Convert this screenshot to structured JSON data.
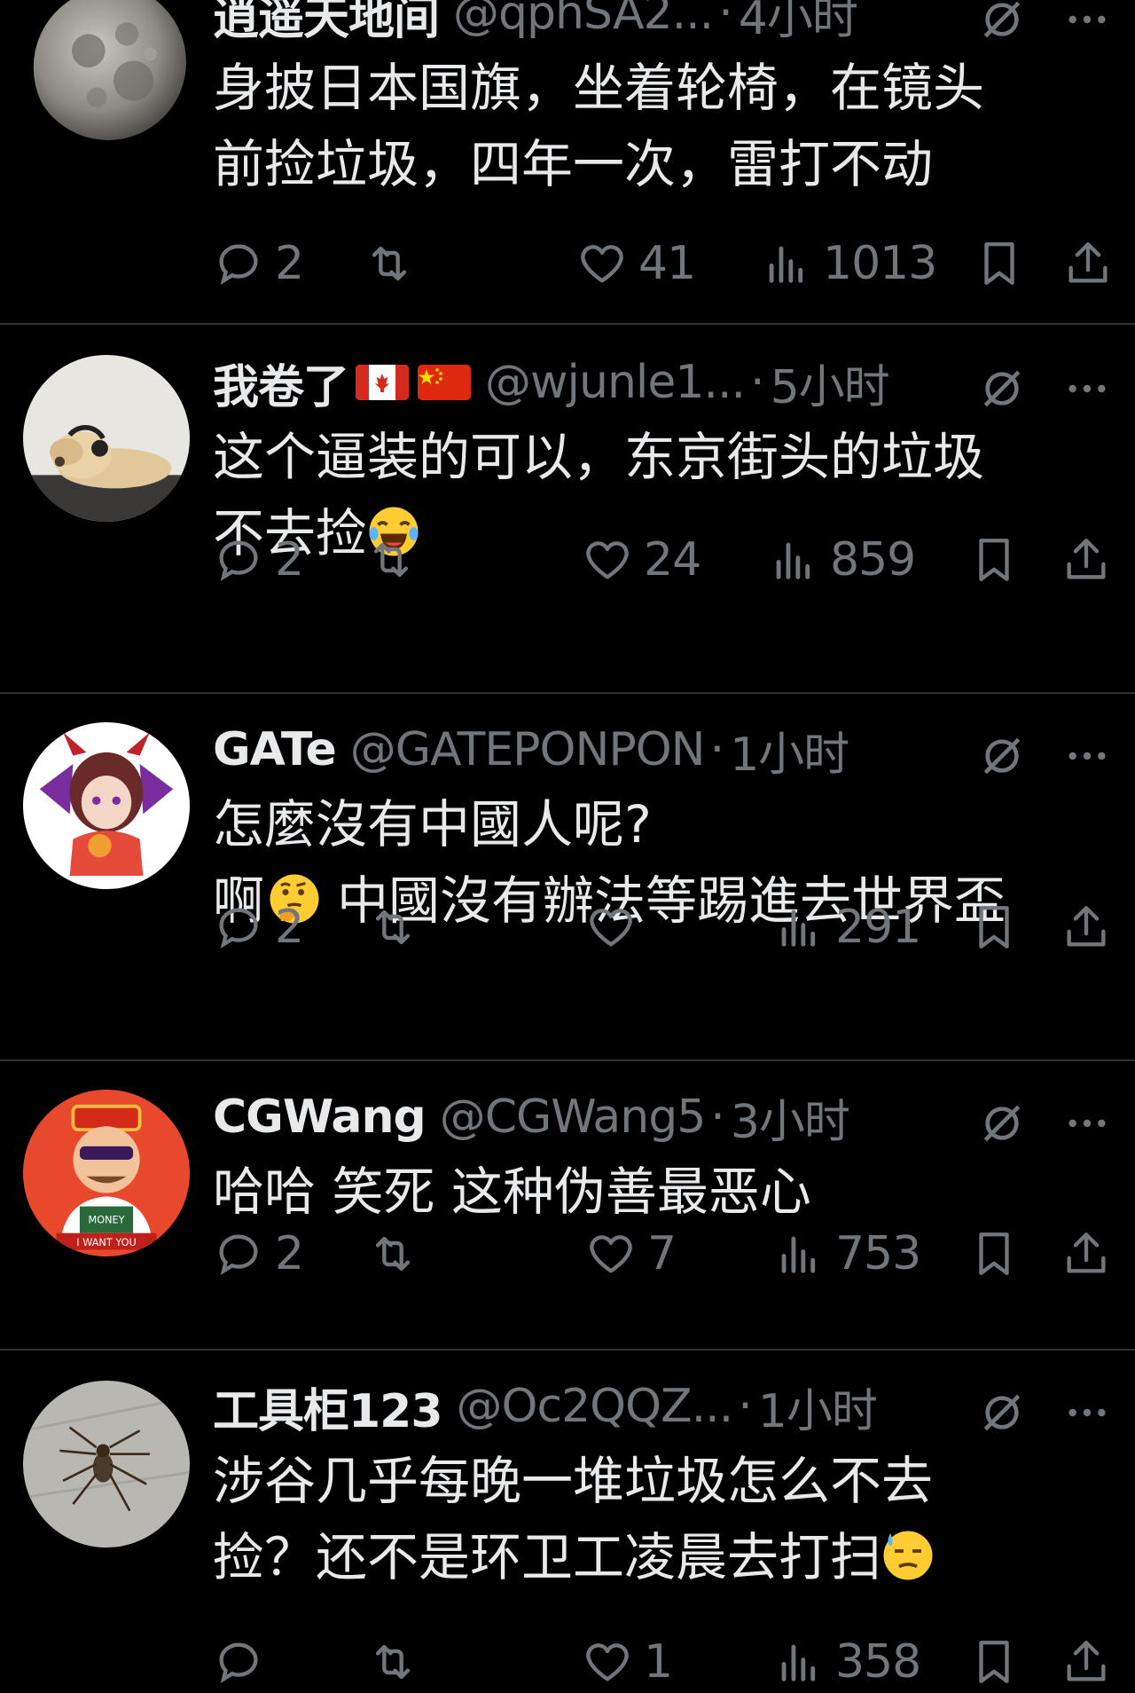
{
  "tweets": [
    {
      "name": "逍遥天地间",
      "handle": "@qphSA2...",
      "sep": "·",
      "time": "4小时",
      "lines": [
        "身披日本国旗，坐着轮椅，在镜头",
        "前捡垃圾，四年一次，雷打不动"
      ],
      "replies": "2",
      "retweets": "",
      "likes": "41",
      "views": "1013"
    },
    {
      "name": "我卷了",
      "handle": "@wjunle1...",
      "sep": "·",
      "time": "5小时",
      "lines": [
        "这个逼装的可以，东京街头的垃圾",
        "不去捡"
      ],
      "replies": "2",
      "retweets": "",
      "likes": "24",
      "views": "859"
    },
    {
      "name": "GATe",
      "handle": "@GATEPONPON",
      "sep": "·",
      "time": "1小时",
      "lines": [
        "怎麼沒有中國人呢?",
        "啊",
        "中國沒有辦法等踢進去世界盃"
      ],
      "replies": "2",
      "retweets": "",
      "likes": "",
      "views": "291"
    },
    {
      "name": "CGWang",
      "handle": "@CGWang5",
      "sep": "·",
      "time": "3小时",
      "lines": [
        "哈哈 笑死 这种伪善最恶心"
      ],
      "replies": "2",
      "retweets": "",
      "likes": "7",
      "views": "753"
    },
    {
      "name": "工具柜123",
      "handle": "@Oc2QQZ...",
      "sep": "·",
      "time": "1小时",
      "lines": [
        "涉谷几乎每晚一堆垃圾怎么不去",
        "捡？还不是环卫工凌晨去打扫"
      ],
      "replies": "",
      "retweets": "",
      "likes": "1",
      "views": "358"
    }
  ],
  "avatar_text": {
    "cgwang_shirt": "MONEY",
    "cgwang_banner": "I WANT YOU"
  },
  "icons": {
    "reply": "reply-icon",
    "retweet": "retweet-icon",
    "like": "heart-icon",
    "views": "views-icon",
    "bookmark": "bookmark-icon",
    "share": "share-icon",
    "mute": "mute-icon",
    "more": "more-icon",
    "flags": [
      "canada-flag-icon",
      "china-flag-icon"
    ],
    "emojis": [
      "laughing-crying-emoji",
      "thinking-emoji",
      "sweat-emoji"
    ]
  },
  "colors": {
    "background": "#000000",
    "text": "#e7e9ea",
    "muted": "#71767b",
    "divider": "#2f3336"
  }
}
